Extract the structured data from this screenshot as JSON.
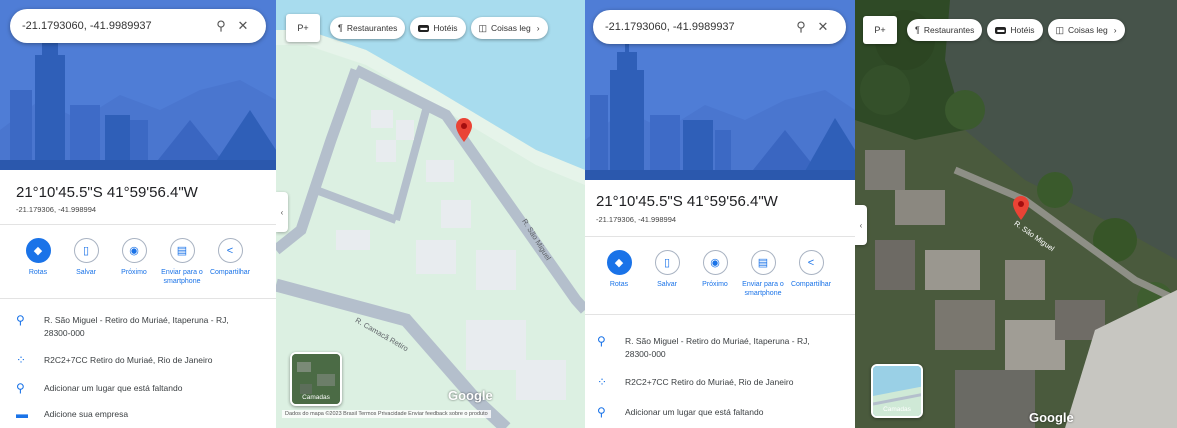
{
  "search": {
    "query": "-21.1793060, -41.9989937"
  },
  "place": {
    "title": "21°10'45.5\"S 41°59'56.4\"W",
    "subtitle": "-21.179306, -41.998994"
  },
  "actions": [
    {
      "label": "Rotas",
      "icon": "directions-icon"
    },
    {
      "label": "Salvar",
      "icon": "bookmark-icon"
    },
    {
      "label": "Próximo",
      "icon": "nearby-icon"
    },
    {
      "label": "Enviar para o smartphone",
      "icon": "send-to-phone-icon"
    },
    {
      "label": "Compartilhar",
      "icon": "share-icon"
    }
  ],
  "info": {
    "address": "R. São Miguel - Retiro do Muriaé, Itaperuna - RJ, 28300-000",
    "pluscode": "R2C2+7CC Retiro do Muriaé, Rio de Janeiro",
    "add_place": "Adicionar um lugar que está faltando",
    "add_business": "Adicione sua empresa"
  },
  "chips": {
    "restaurants": "Restaurantes",
    "hotels": "Hotéis",
    "things": "Coisas leg",
    "pegman": "P+"
  },
  "map": {
    "layers_label": "Camadas",
    "street1": "R. São Miguel",
    "street2": "R. Camacã Retiro",
    "sat_street": "R. São Miguel",
    "footer": "Dados do mapa ©2023   Brasil   Termos   Privacidade   Enviar feedback sobre o produto",
    "brand": "Google"
  },
  "colors": {
    "hero": "#4f7dd6",
    "accent": "#1a73e8",
    "water": "#a8dcee",
    "land": "#dcf0e2",
    "road": "#b4bfcc",
    "pin": "#ea4335"
  }
}
